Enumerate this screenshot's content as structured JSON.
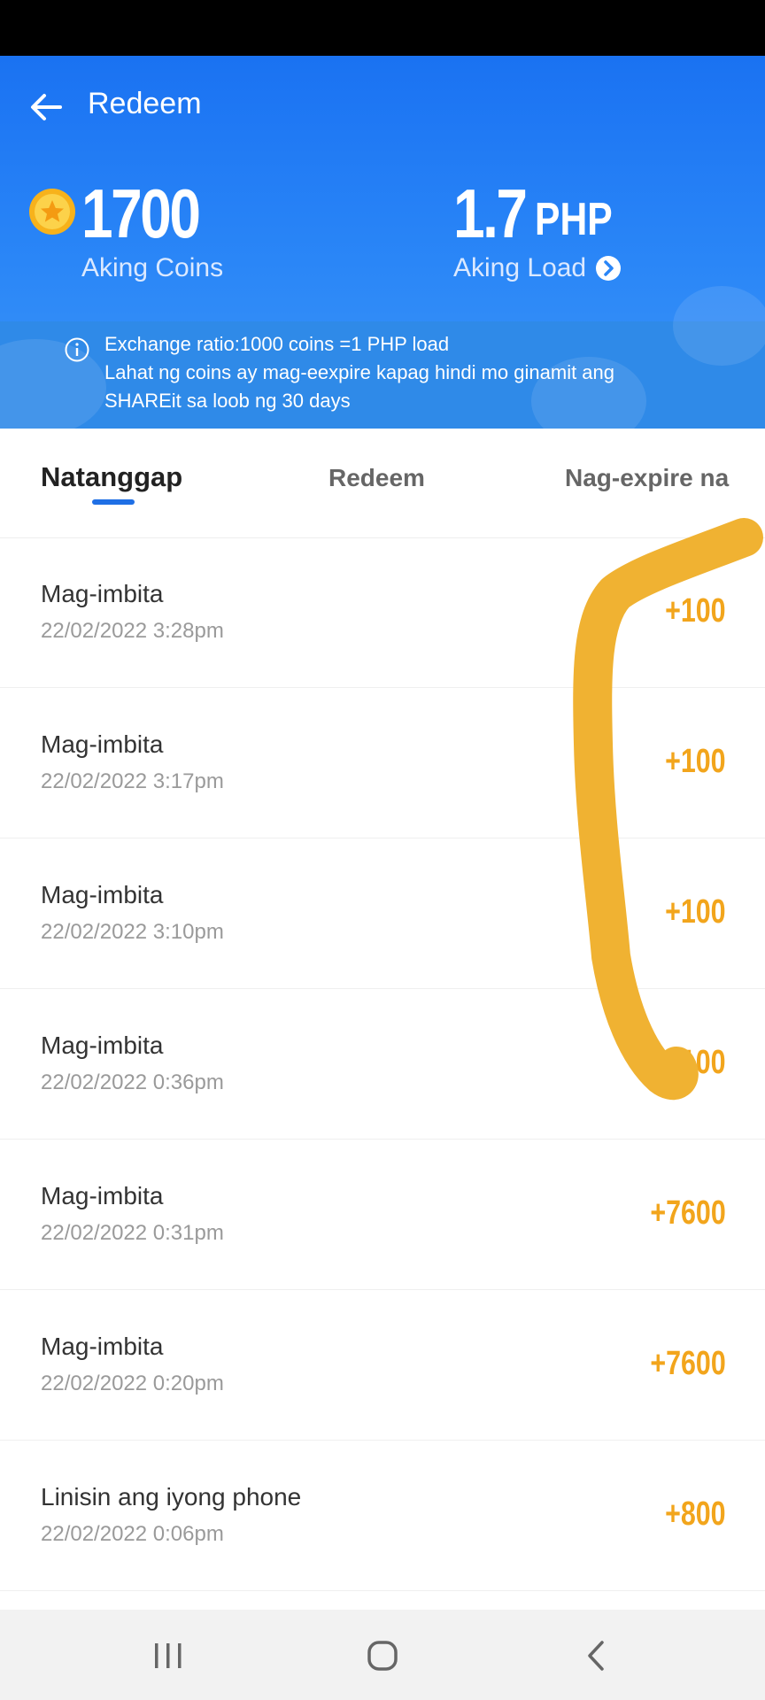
{
  "header": {
    "title": "Redeem",
    "coins_value": "1700",
    "coins_label": "Aking Coins",
    "load_value": "1.7",
    "load_unit": "PHP",
    "load_label": "Aking Load"
  },
  "info": {
    "line1": "Exchange ratio:1000 coins =1 PHP load",
    "line2": "Lahat ng coins ay mag-eexpire kapag hindi mo ginamit ang",
    "line3": "SHAREit sa loob ng 30 days"
  },
  "tabs": [
    {
      "label": "Natanggap",
      "active": true
    },
    {
      "label": "Redeem",
      "active": false
    },
    {
      "label": "Nag-expire na",
      "active": false
    }
  ],
  "transactions": [
    {
      "title": "Mag-imbita",
      "date": "22/02/2022 3:28pm",
      "amount": "+100"
    },
    {
      "title": "Mag-imbita",
      "date": "22/02/2022 3:17pm",
      "amount": "+100"
    },
    {
      "title": "Mag-imbita",
      "date": "22/02/2022 3:10pm",
      "amount": "+100"
    },
    {
      "title": "Mag-imbita",
      "date": "22/02/2022 0:36pm",
      "amount": "+100"
    },
    {
      "title": "Mag-imbita",
      "date": "22/02/2022 0:31pm",
      "amount": "+7600"
    },
    {
      "title": "Mag-imbita",
      "date": "22/02/2022 0:20pm",
      "amount": "+7600"
    },
    {
      "title": "Linisin ang iyong phone",
      "date": "22/02/2022 0:06pm",
      "amount": "+800"
    }
  ],
  "colors": {
    "header_blue": "#1a72f2",
    "amount_orange": "#f2a51c",
    "tab_indicator": "#1f6fe5",
    "scribble": "#f0b232"
  },
  "icons": {
    "back": "arrow-left-icon",
    "coin": "coin-icon",
    "load_chevron": "chevron-right-circle-icon",
    "info": "info-icon",
    "nav_recent": "recent-apps-icon",
    "nav_home": "home-icon",
    "nav_back": "chevron-left-icon"
  }
}
